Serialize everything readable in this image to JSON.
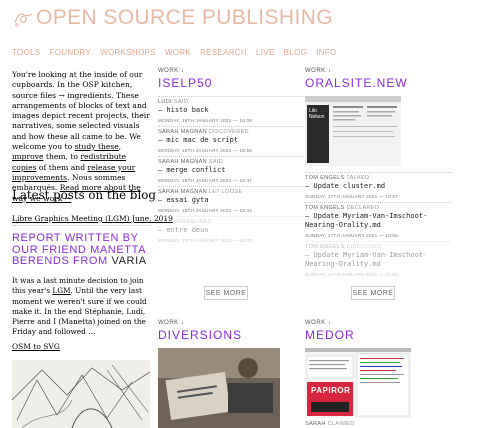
{
  "header": {
    "brand": "OPEN SOURCE PUBLISHING",
    "nav": [
      "TOOLS",
      "FOUNDRY",
      "WORKSHOPS",
      "WORK",
      "RESEARCH",
      "LIVE",
      "BLOG",
      "INFO"
    ]
  },
  "intro": {
    "t1": "You're looking at the inside of our cupboards. In the OSP kitchen, source files → ingredients. These arrangements of blocks of text and images depict recent projects, their narratives, some selected visuals and how these all came to be. We welcome you to ",
    "link1": "study these",
    "t2": ", ",
    "link2": "improve",
    "t3": " them, to ",
    "link3": "redistribute copies",
    "t4": " of them and ",
    "link4": "release your improvements",
    "t5": ". Nous sommes embarqués. ",
    "link5": "Read more about the way we work →"
  },
  "blog": {
    "title": "Latest posts on the blog",
    "link": "Libre Graphics Meeting (LGM) June, 2019",
    "post_head": "REPORT WRITTEN BY OUR FRIEND MANETTA BERENDS FROM ",
    "post_head_end": "VARIA",
    "post_body_1": "It was a last minute decision to join this year's ",
    "post_body_link": "LGM",
    "post_body_2": ". Until the very last moment we weren't sure if we could make it. In the end Stéphanie, Ludi, Pierre and I (Manetta) joined on the Friday and followed …",
    "osm_link": "OSM to SVG"
  },
  "col1": {
    "kicker": "WORK ↓",
    "title": "ISELP50",
    "entries": [
      {
        "author": "LUDI",
        "verb": "SAID",
        "msg": "— histo back",
        "date": "MONDAY, 18TH JANUARY 2021 — 16:08"
      },
      {
        "author": "SARAH MAGNAN",
        "verb": "DISCOVERED",
        "msg": "— mic mac de script",
        "date": "MONDAY, 18TH JANUARY 2021 — 15:56"
      },
      {
        "author": "SARAH MAGNAN",
        "verb": "SAID",
        "msg": "— merge conflict",
        "date": "MONDAY, 18TH JANUARY 2021 — 15:47"
      },
      {
        "author": "SARAH MAGNAN",
        "verb": "LET LOOSE",
        "msg": "— essai ġyta",
        "date": "MONDAY, 18TH JANUARY 2021 — 15:44"
      },
      {
        "author": "LUDI",
        "verb": "VERBALISED",
        "msg": "— entre deux",
        "date": "MONDAY, 18TH JANUARY 2021 — 16:03"
      }
    ],
    "more": "SEE MORE"
  },
  "col2": {
    "kicker": "WORK ↓",
    "title": "ORALSITE.NEW",
    "entries": [
      {
        "author": "TOM ENGELS",
        "verb": "TALKED",
        "msg": "— Update cluster.md",
        "date": "SUNDAY, 17TH JANUARY 2021 — 10:57"
      },
      {
        "author": "TOM ENGELS",
        "verb": "DECLARED",
        "msg": "— Update Myriam-Van-Imschoot-Nearing-Orality.md",
        "date": "SUNDAY, 17TH JANUARY 2021 — 10:56"
      },
      {
        "author": "TOM ENGELS",
        "verb": "DISCLOSED",
        "msg": "— Update Myriam-Van-Imschoot-Nearing-Orality.md",
        "date": "SUNDAY, 17TH JANUARY 2021 — 10:51"
      }
    ],
    "thumb_label": "Lilo\nNelson",
    "more": "SEE MORE"
  },
  "col3": {
    "kicker": "WORK ↓",
    "title": "DIVERSIONS"
  },
  "col4": {
    "kicker": "WORK ↓",
    "title": "MEDOR",
    "thumb_label": "PAPIROR",
    "entry_author": "SARAH",
    "entry_verb": "CLAIMED"
  },
  "colors": {
    "accent": "#8a2be2",
    "brand": "#e7b9a4"
  }
}
